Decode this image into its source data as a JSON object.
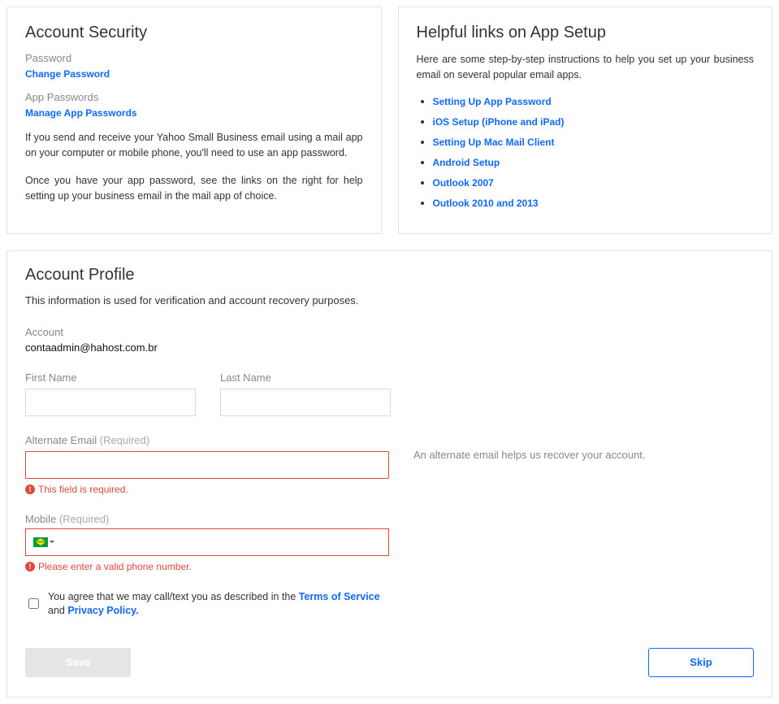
{
  "security": {
    "title": "Account Security",
    "password_label": "Password",
    "change_password_link": "Change Password",
    "app_passwords_label": "App Passwords",
    "manage_app_passwords_link": "Manage App Passwords",
    "para1": "If you send and receive your Yahoo Small Business email using a mail app on your computer or mobile phone, you'll need to use an app password.",
    "para2": "Once you have your app password, see the links on the right for help setting up your business email in the mail app of choice."
  },
  "helpful": {
    "title": "Helpful links on App Setup",
    "intro": "Here are some step-by-step instructions to help you set up your business email on several popular email apps.",
    "links": [
      "Setting Up App Password",
      "iOS Setup (iPhone and iPad)",
      "Setting Up Mac Mail Client",
      "Android Setup",
      "Outlook 2007",
      "Outlook 2010 and 2013"
    ]
  },
  "profile": {
    "title": "Account Profile",
    "desc": "This information is used for verification and account recovery purposes.",
    "account_label": "Account",
    "account_value": "contaadmin@hahost.com.br",
    "first_name_label": "First Name",
    "first_name_value": "",
    "last_name_label": "Last Name",
    "last_name_value": "",
    "alt_email_label": "Alternate Email ",
    "required_tag": "(Required)",
    "alt_email_value": "",
    "alt_email_help": "An alternate email helps us recover your account.",
    "alt_email_error": "This field is required.",
    "mobile_label": "Mobile ",
    "mobile_value": "",
    "mobile_error": "Please enter a valid phone number.",
    "consent_prefix": "You agree that we may call/text you as described in the ",
    "terms_link": "Terms of Service",
    "consent_and": " and ",
    "privacy_link": "Privacy Policy.",
    "save_label": "Save",
    "skip_label": "Skip"
  }
}
